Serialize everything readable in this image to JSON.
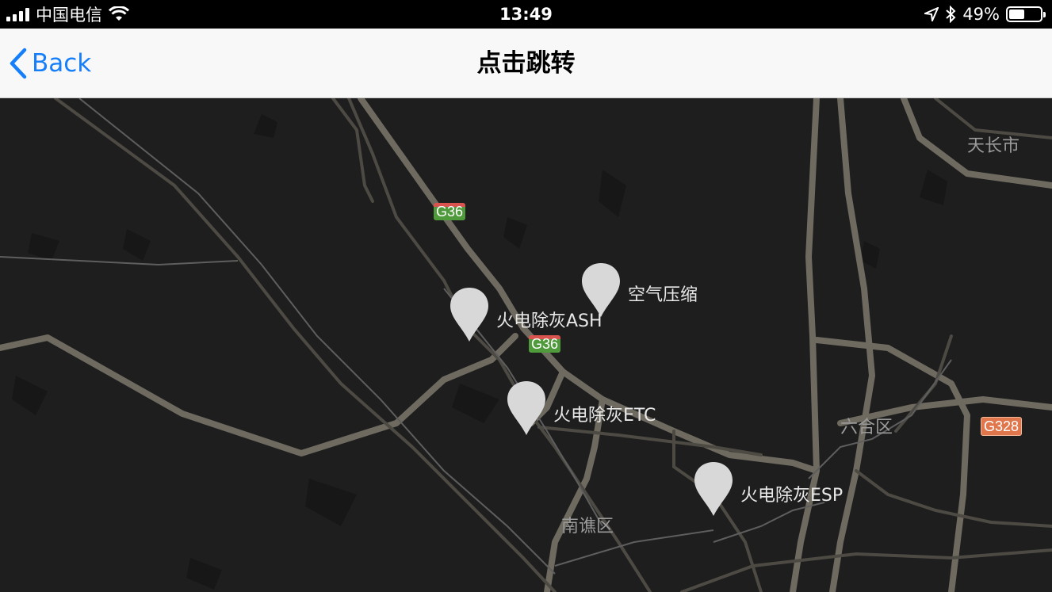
{
  "status_bar": {
    "carrier": "中国电信",
    "time": "13:49",
    "battery_percent": "49%",
    "battery_level": 0.49,
    "icons": [
      "signal-icon",
      "wifi-icon",
      "location-icon",
      "bluetooth-icon",
      "battery-icon"
    ]
  },
  "nav": {
    "back_label": "Back",
    "title": "点击跳转"
  },
  "map": {
    "road_shields": [
      "G36",
      "G36",
      "G328"
    ],
    "places": [
      "天长市",
      "六合区",
      "南谯区"
    ],
    "markers": [
      {
        "label": "空气压缩"
      },
      {
        "label": "火电除灰ASH"
      },
      {
        "label": "火电除灰ETC"
      },
      {
        "label": "火电除灰ESP"
      }
    ]
  },
  "colors": {
    "accent": "#157efb",
    "map_background": "#1e1e1e",
    "marker": "#d8d8d8"
  }
}
